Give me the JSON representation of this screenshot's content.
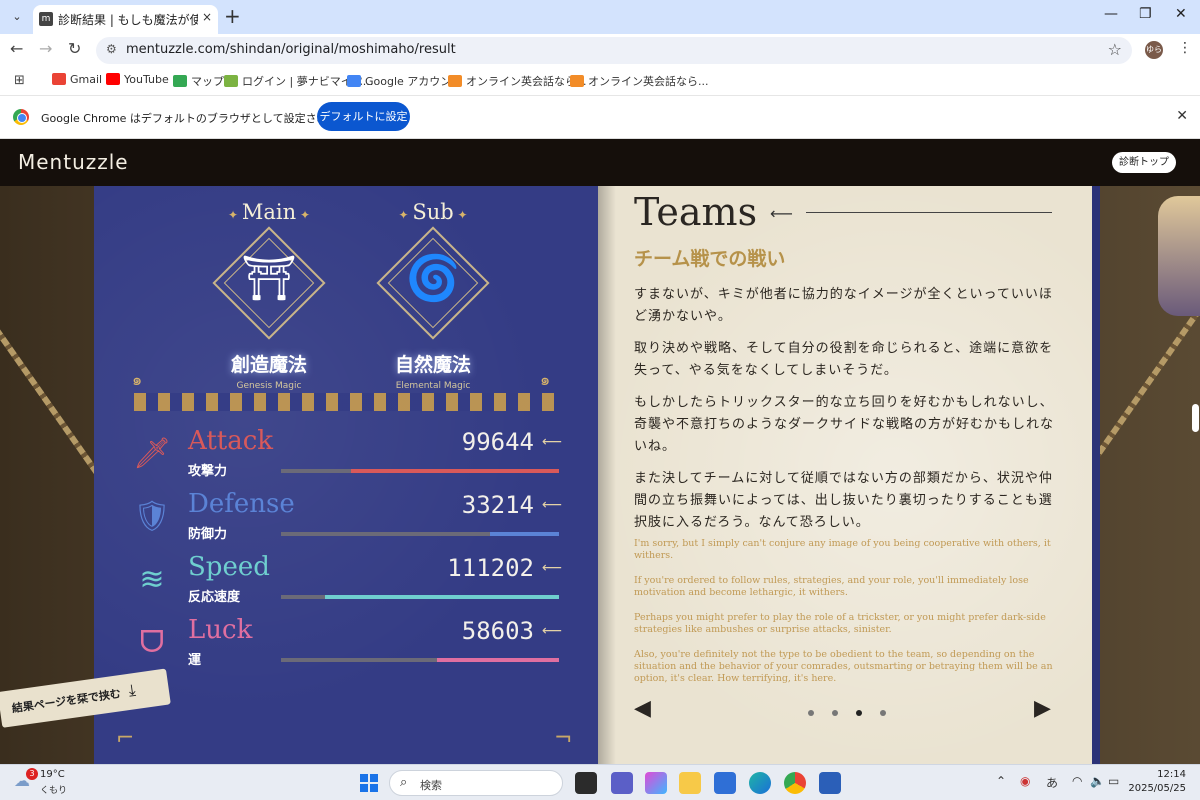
{
  "browser": {
    "tab_title": "診断結果 | もしも魔法が使えたら？",
    "tab_close": "×",
    "new_tab": "+",
    "url": "mentuzzle.com/shindan/original/moshimaho/result",
    "profile_initial": "ゆら",
    "bookmarks": [
      {
        "label": "Gmail",
        "color": "#ea4335"
      },
      {
        "label": "YouTube",
        "color": "#ff0000"
      },
      {
        "label": "マップ",
        "color": "#34a853"
      },
      {
        "label": "ログイン | 夢ナビマイペ...",
        "color": "#7cb342"
      },
      {
        "label": "Google アカウント",
        "color": "#4285f4"
      },
      {
        "label": "オンライン英会話なら...",
        "color": "#f28c28"
      },
      {
        "label": "オンライン英会話なら...",
        "color": "#f28c28"
      }
    ],
    "infobar": {
      "message": "Google Chrome はデフォルトのブラウザとして設定されていません",
      "button": "デフォルトに設定"
    }
  },
  "site": {
    "logo": "Mentuzzle",
    "top_button": "診断トップ"
  },
  "magic": {
    "main": {
      "head": "Main",
      "name": "創造魔法",
      "en": "Genesis Magic",
      "glyph": "⛩"
    },
    "sub": {
      "head": "Sub",
      "name": "自然魔法",
      "en": "Elemental Magic",
      "glyph": "🌀"
    }
  },
  "stats": [
    {
      "en": "Attack",
      "jp": "攻撃力",
      "value": "99644",
      "fraction": 0.75,
      "color": "#d9595a",
      "icon": "sword-icon",
      "glyph": "🗡"
    },
    {
      "en": "Defense",
      "jp": "防御力",
      "value": "33214",
      "fraction": 0.25,
      "color": "#5b83d6",
      "icon": "shield-icon",
      "glyph": "🛡"
    },
    {
      "en": "Speed",
      "jp": "反応速度",
      "value": "111202",
      "fraction": 0.84,
      "color": "#6fcfcf",
      "icon": "wind-icon",
      "glyph": "≋"
    },
    {
      "en": "Luck",
      "jp": "運",
      "value": "58603",
      "fraction": 0.44,
      "color": "#e06fa0",
      "icon": "amulet-icon",
      "glyph": "ᗜ"
    }
  ],
  "bookmark_button": "結果ページを栞で挟む",
  "teams": {
    "title": "Teams",
    "subtitle": "チーム戦での戦い",
    "jp_paragraphs": [
      "すまないが、キミが他者に協力的なイメージが全くといっていいほど湧かないや。",
      "取り決めや戦略、そして自分の役割を命じられると、途端に意欲を失って、やる気をなくしてしまいそうだ。",
      "もしかしたらトリックスター的な立ち回りを好むかもしれないし、奇襲や不意打ちのようなダークサイドな戦略の方が好むかもしれないね。",
      "また決してチームに対して従順ではない方の部類だから、状況や仲間の立ち振舞いによっては、出し抜いたり裏切ったりすることも選択肢に入るだろう。なんて恐ろしい。"
    ],
    "en_paragraphs": [
      "I'm sorry, but I simply can't conjure any image of you being cooperative with others, it withers.",
      "If you're ordered to follow rules, strategies, and your role, you'll immediately lose motivation and become lethargic, it withers.",
      "Perhaps you might prefer to play the role of a trickster, or you might prefer dark-side strategies like ambushes or surprise attacks, sinister.",
      "Also, you're definitely not the type to be obedient to the team, so depending on the situation and the behavior of your comrades, outsmarting or betraying them will be an option, it's clear. How terrifying, it's here."
    ],
    "page_count": 4,
    "active_page": 3
  },
  "taskbar": {
    "weather_badge": "3",
    "temperature": "19°C",
    "weather": "くもり",
    "search_placeholder": "検索",
    "ime": "あ",
    "time": "12:14",
    "date": "2025/05/25"
  }
}
